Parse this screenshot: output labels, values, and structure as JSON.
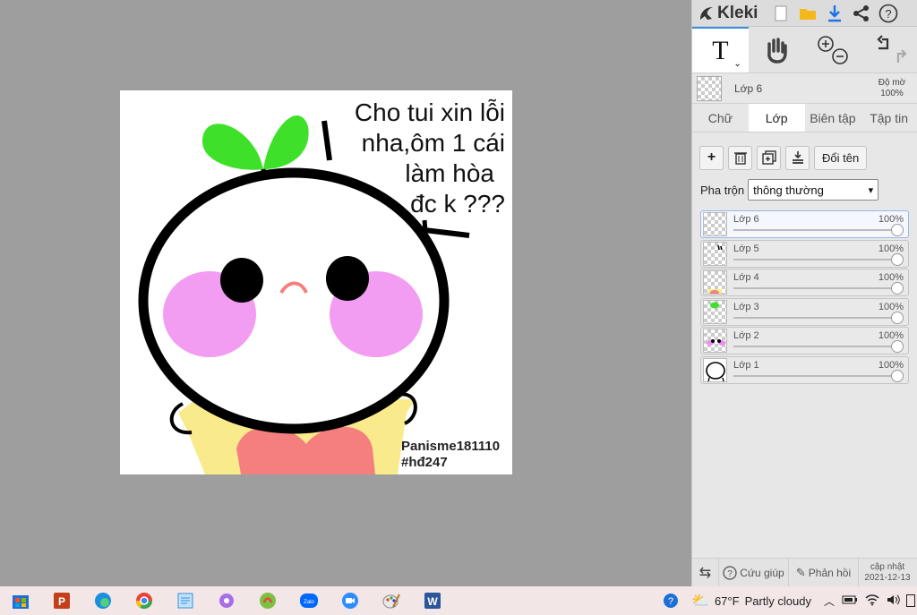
{
  "canvas": {
    "speech_lines": [
      "Cho tui xin lỗi",
      "nha,ôm 1 cái",
      "làm hòa",
      "đc k ???"
    ],
    "watermark_lines": [
      "Panisme181110",
      "#hđ247"
    ]
  },
  "app": {
    "logo_text": "Kleki",
    "top_icons": [
      "new-image-icon",
      "open-folder-icon",
      "download-icon",
      "share-icon",
      "help-icon"
    ]
  },
  "layer_info": {
    "name": "Lớp 6",
    "opacity_label": "Độ mờ",
    "opacity_value": "100%"
  },
  "tabs": [
    {
      "label": "Chữ",
      "active": false
    },
    {
      "label": "Lớp",
      "active": true
    },
    {
      "label": "Biên tập",
      "active": false
    },
    {
      "label": "Tập tin",
      "active": false
    }
  ],
  "layer_buttons": {
    "rename_label": "Đổi tên"
  },
  "blend": {
    "label": "Pha trộn",
    "value": "thông thường"
  },
  "layers": [
    {
      "name": "Lớp 6",
      "opacity": "100%",
      "selected": true
    },
    {
      "name": "Lớp 5",
      "opacity": "100%",
      "selected": false
    },
    {
      "name": "Lớp 4",
      "opacity": "100%",
      "selected": false
    },
    {
      "name": "Lớp 3",
      "opacity": "100%",
      "selected": false
    },
    {
      "name": "Lớp 2",
      "opacity": "100%",
      "selected": false
    },
    {
      "name": "Lớp 1",
      "opacity": "100%",
      "selected": false
    }
  ],
  "bottom": {
    "help_label": "Cứu giúp",
    "feedback_label": "Phản hồi",
    "update_label": "cập nhật",
    "update_date": "2021-12-13"
  },
  "taskbar": {
    "weather_temp": "67°F",
    "weather_text": "Partly cloudy",
    "apps": [
      "windows-store-icon",
      "powerpoint-icon",
      "edge-icon",
      "chrome-icon",
      "notepad-icon",
      "flower-app-icon",
      "kleki-app-icon",
      "zalo-icon",
      "zoom-icon",
      "paint-icon",
      "word-icon"
    ]
  },
  "colors": {
    "accent": "#3a8ee6",
    "leaf_green": "#3fe02a",
    "blush_pink": "#f08cf0",
    "shirt_yellow": "#f9eb8c",
    "heart_red": "#f57f7f"
  }
}
